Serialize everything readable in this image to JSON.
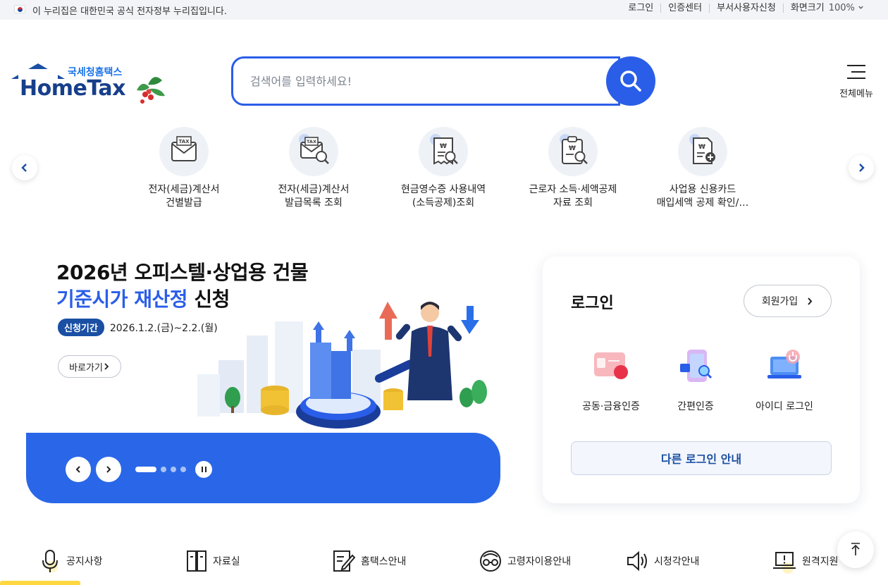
{
  "topbar": {
    "gov_notice": "이 누리집은 대한민국 공식 전자정부 누리집입니다.",
    "links": [
      "로그인",
      "인증센터",
      "부서사용자신청",
      "화면크기"
    ],
    "zoom_level": "100%"
  },
  "logo": {
    "sub": "국세청홈택스",
    "main": "HomeTax"
  },
  "search": {
    "placeholder": "검색어를 입력하세요!"
  },
  "all_menu_label": "전체메뉴",
  "quick_menu": [
    {
      "label": "전자(세금)계산서\n건별발급",
      "icon": "tax-envelope-icon"
    },
    {
      "label": "전자(세금)계산서\n발급목록 조회",
      "icon": "tax-search-icon"
    },
    {
      "label": "현금영수증 사용내역\n(소득공제)조회",
      "icon": "receipt-search-icon"
    },
    {
      "label": "근로자 소득·세액공제\n자료 조회",
      "icon": "clipboard-search-icon"
    },
    {
      "label": "사업용 신용카드\n매입세액 공제 확인/…",
      "icon": "document-add-icon"
    }
  ],
  "banner": {
    "title_line1": "2026년 오피스텔·상업용 건물",
    "title_line2_blue": "기준시가 재산정",
    "title_line2_rest": " 신청",
    "period_tag": "신청기간",
    "period_dates": "2026.1.2.(금)~2.2.(월)",
    "goto_label": "바로가기",
    "slide_count": 4,
    "active_slide": 1
  },
  "login": {
    "title": "로그인",
    "signup_label": "회원가입",
    "methods": [
      "공동·금융인증",
      "간편인증",
      "아이디 로그인"
    ],
    "other_label": "다른 로그인 안내"
  },
  "bottom_menu": [
    "공지사항",
    "자료실",
    "홈택스안내",
    "고령자이용안내",
    "시청각안내",
    "원격지원"
  ],
  "colors": {
    "primary": "#2a5ee8",
    "navy": "#1a4fa3",
    "banner_bar": "#2a67e8"
  }
}
